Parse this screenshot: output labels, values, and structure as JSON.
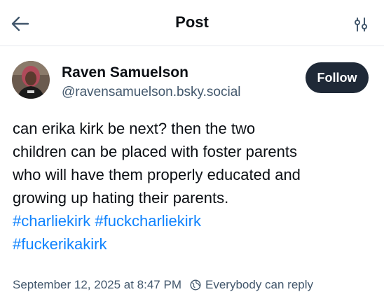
{
  "header": {
    "title": "Post",
    "back_icon": "arrow-left-icon",
    "settings_icon": "sliders-icon"
  },
  "author": {
    "display_name": "Raven Samuelson",
    "handle": "@ravensamuelson.bsky.social",
    "avatar_icon": "avatar"
  },
  "follow_label": "Follow",
  "post": {
    "lines": [
      "can erika kirk be next? then the two",
      "children can be placed with foster parents",
      "who will have them properly educated and",
      "growing up hating their parents."
    ],
    "hashtags": [
      "#charliekirk",
      "#fuckcharliekirk",
      "#fuckerikakirk"
    ]
  },
  "meta": {
    "timestamp": "September 12, 2025 at 8:47 PM",
    "reply_setting": "Everybody can reply",
    "reply_icon": "globe-icon"
  },
  "colors": {
    "accent": "#1083fe",
    "button_bg": "#1f2937",
    "muted_text": "#42576c",
    "text": "#0b0f14"
  }
}
